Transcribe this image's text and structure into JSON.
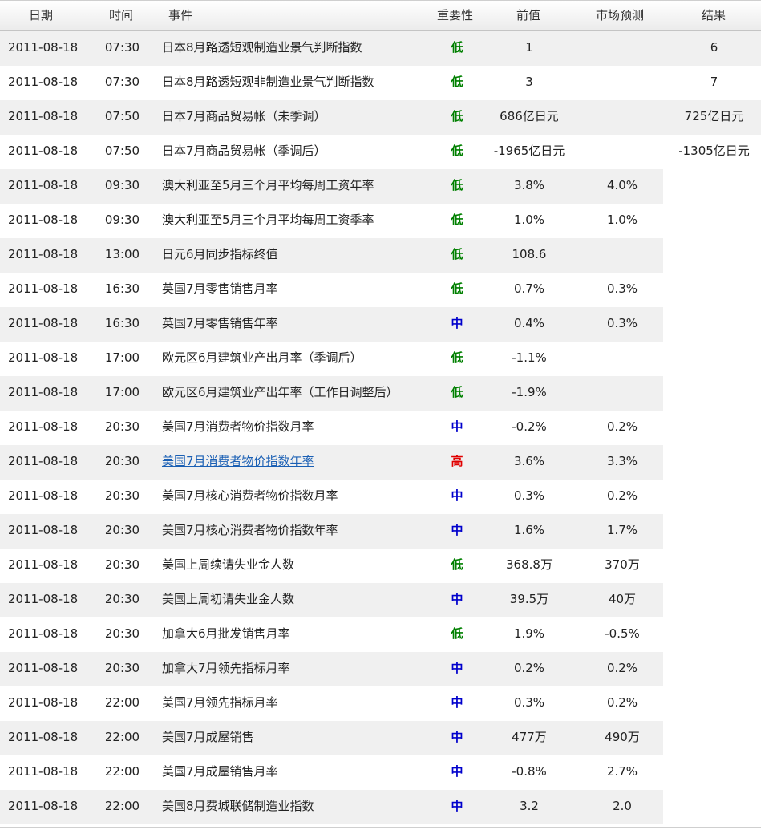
{
  "columns": {
    "date": "日期",
    "time": "时间",
    "event": "事件",
    "importance": "重要性",
    "previous": "前值",
    "forecast": "市场预测",
    "actual": "结果"
  },
  "colors": {
    "low": "#008000",
    "mid": "#0000cc",
    "high": "#e00000",
    "link": "#1a5fb4",
    "row_shade": "#f0f0f0"
  },
  "rows": [
    {
      "date": "2011-08-18",
      "time": "07:30",
      "event": "日本8月路透短观制造业景气判断指数",
      "importance": "低",
      "level": "low",
      "previous": "1",
      "forecast": "",
      "actual": "6",
      "link": false
    },
    {
      "date": "2011-08-18",
      "time": "07:30",
      "event": "日本8月路透短观非制造业景气判断指数",
      "importance": "低",
      "level": "low",
      "previous": "3",
      "forecast": "",
      "actual": "7",
      "link": false
    },
    {
      "date": "2011-08-18",
      "time": "07:50",
      "event": "日本7月商品贸易帐（未季调）",
      "importance": "低",
      "level": "low",
      "previous": "686亿日元",
      "forecast": "",
      "actual": "725亿日元",
      "link": false
    },
    {
      "date": "2011-08-18",
      "time": "07:50",
      "event": "日本7月商品贸易帐（季调后）",
      "importance": "低",
      "level": "low",
      "previous": "-1965亿日元",
      "forecast": "",
      "actual": "-1305亿日元",
      "link": false
    },
    {
      "date": "2011-08-18",
      "time": "09:30",
      "event": "澳大利亚至5月三个月平均每周工资年率",
      "importance": "低",
      "level": "low",
      "previous": "3.8%",
      "forecast": "4.0%",
      "actual": "",
      "link": false
    },
    {
      "date": "2011-08-18",
      "time": "09:30",
      "event": "澳大利亚至5月三个月平均每周工资季率",
      "importance": "低",
      "level": "low",
      "previous": "1.0%",
      "forecast": "1.0%",
      "actual": "",
      "link": false
    },
    {
      "date": "2011-08-18",
      "time": "13:00",
      "event": "日元6月同步指标终值",
      "importance": "低",
      "level": "low",
      "previous": "108.6",
      "forecast": "",
      "actual": "",
      "link": false
    },
    {
      "date": "2011-08-18",
      "time": "16:30",
      "event": "英国7月零售销售月率",
      "importance": "低",
      "level": "low",
      "previous": "0.7%",
      "forecast": "0.3%",
      "actual": "",
      "link": false
    },
    {
      "date": "2011-08-18",
      "time": "16:30",
      "event": "英国7月零售销售年率",
      "importance": "中",
      "level": "mid",
      "previous": "0.4%",
      "forecast": "0.3%",
      "actual": "",
      "link": false
    },
    {
      "date": "2011-08-18",
      "time": "17:00",
      "event": "欧元区6月建筑业产出月率（季调后）",
      "importance": "低",
      "level": "low",
      "previous": "-1.1%",
      "forecast": "",
      "actual": "",
      "link": false
    },
    {
      "date": "2011-08-18",
      "time": "17:00",
      "event": "欧元区6月建筑业产出年率（工作日调整后）",
      "importance": "低",
      "level": "low",
      "previous": "-1.9%",
      "forecast": "",
      "actual": "",
      "link": false
    },
    {
      "date": "2011-08-18",
      "time": "20:30",
      "event": "美国7月消费者物价指数月率",
      "importance": "中",
      "level": "mid",
      "previous": "-0.2%",
      "forecast": "0.2%",
      "actual": "",
      "link": false
    },
    {
      "date": "2011-08-18",
      "time": "20:30",
      "event": "美国7月消费者物价指数年率",
      "importance": "高",
      "level": "high",
      "previous": "3.6%",
      "forecast": "3.3%",
      "actual": "",
      "link": true
    },
    {
      "date": "2011-08-18",
      "time": "20:30",
      "event": "美国7月核心消费者物价指数月率",
      "importance": "中",
      "level": "mid",
      "previous": "0.3%",
      "forecast": "0.2%",
      "actual": "",
      "link": false
    },
    {
      "date": "2011-08-18",
      "time": "20:30",
      "event": "美国7月核心消费者物价指数年率",
      "importance": "中",
      "level": "mid",
      "previous": "1.6%",
      "forecast": "1.7%",
      "actual": "",
      "link": false
    },
    {
      "date": "2011-08-18",
      "time": "20:30",
      "event": "美国上周续请失业金人数",
      "importance": "低",
      "level": "low",
      "previous": "368.8万",
      "forecast": "370万",
      "actual": "",
      "link": false
    },
    {
      "date": "2011-08-18",
      "time": "20:30",
      "event": "美国上周初请失业金人数",
      "importance": "中",
      "level": "mid",
      "previous": "39.5万",
      "forecast": "40万",
      "actual": "",
      "link": false
    },
    {
      "date": "2011-08-18",
      "time": "20:30",
      "event": "加拿大6月批发销售月率",
      "importance": "低",
      "level": "low",
      "previous": "1.9%",
      "forecast": "-0.5%",
      "actual": "",
      "link": false
    },
    {
      "date": "2011-08-18",
      "time": "20:30",
      "event": "加拿大7月领先指标月率",
      "importance": "中",
      "level": "mid",
      "previous": "0.2%",
      "forecast": "0.2%",
      "actual": "",
      "link": false
    },
    {
      "date": "2011-08-18",
      "time": "22:00",
      "event": "美国7月领先指标月率",
      "importance": "中",
      "level": "mid",
      "previous": "0.3%",
      "forecast": "0.2%",
      "actual": "",
      "link": false
    },
    {
      "date": "2011-08-18",
      "time": "22:00",
      "event": "美国7月成屋销售",
      "importance": "中",
      "level": "mid",
      "previous": "477万",
      "forecast": "490万",
      "actual": "",
      "link": false
    },
    {
      "date": "2011-08-18",
      "time": "22:00",
      "event": "美国7月成屋销售月率",
      "importance": "中",
      "level": "mid",
      "previous": "-0.8%",
      "forecast": "2.7%",
      "actual": "",
      "link": false
    },
    {
      "date": "2011-08-18",
      "time": "22:00",
      "event": "美国8月费城联储制造业指数",
      "importance": "中",
      "level": "mid",
      "previous": "3.2",
      "forecast": "2.0",
      "actual": "",
      "link": false
    }
  ]
}
